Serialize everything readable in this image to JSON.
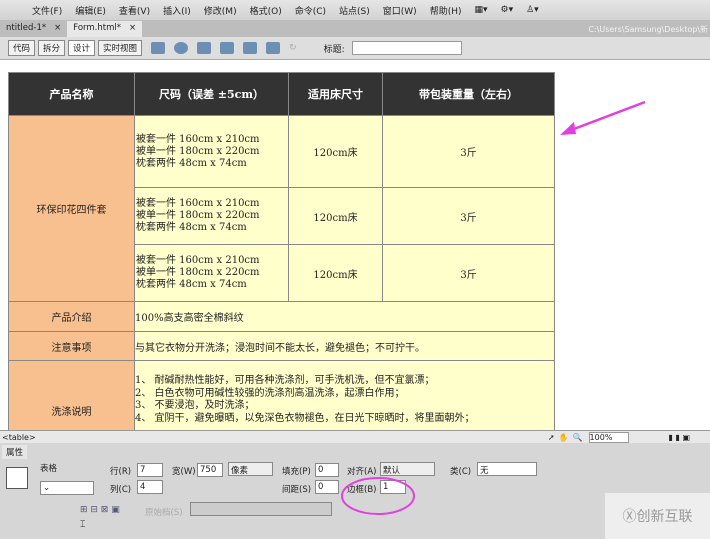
{
  "menu": [
    "文件(F)",
    "编辑(E)",
    "查看(V)",
    "插入(I)",
    "修改(M)",
    "格式(O)",
    "命令(C)",
    "站点(S)",
    "窗口(W)",
    "帮助(H)"
  ],
  "tabs": [
    {
      "label": "ntitled-1*"
    },
    {
      "label": "Form.html*"
    }
  ],
  "path": "C:\\Users\\Samsung\\Desktop\\新",
  "toolbar": {
    "views": [
      "代码",
      "拆分",
      "设计",
      "实时视图"
    ],
    "title_label": "标题:"
  },
  "table": {
    "headers": [
      "产品名称",
      "尺码（误差 ±5cm）",
      "适用床尺寸",
      "带包装重量（左右）"
    ],
    "product": "环保印花四件套",
    "size_lines": [
      "被套一件 160cm x 210cm",
      "被单一件 180cm x 220cm",
      "枕套两件 48cm x 74cm"
    ],
    "bed": "120cm床",
    "weight": "3斤",
    "intro_label": "产品介绍",
    "intro": "100%高支高密全棉斜纹",
    "notes_label": "注意事项",
    "notes": "与其它衣物分开洗涤；浸泡时间不能太长，避免褪色；不可拧干。",
    "wash_label": "洗涤说明",
    "wash": [
      "1、 耐碱耐热性能好，可用各种洗涤剂，可手洗机洗，但不宜氯漂；",
      "2、 白色衣物可用碱性较强的洗涤剂高温洗涤，起漂白作用；",
      "3、 不要浸泡，及时洗涤；",
      "4、 宜阴干，避免曝晒，以免深色衣物褪色，在日光下晾晒时，将里面朝外；"
    ]
  },
  "status": {
    "tag": "<table>",
    "zoom": "100%"
  },
  "props": {
    "tab": "属性",
    "type": "表格",
    "rows_label": "行(R)",
    "rows": "7",
    "cols_label": "列(C)",
    "cols": "4",
    "width_label": "宽(W)",
    "width": "750",
    "unit": "像素",
    "pad_label": "填充(P)",
    "pad": "0",
    "space_label": "间距(S)",
    "space": "0",
    "align_label": "对齐(A)",
    "align": "默认",
    "border_label": "边框(B)",
    "border": "1",
    "class_label": "类(C)",
    "class": "无",
    "src_label": "原始档(S)"
  },
  "watermark": "创新互联"
}
